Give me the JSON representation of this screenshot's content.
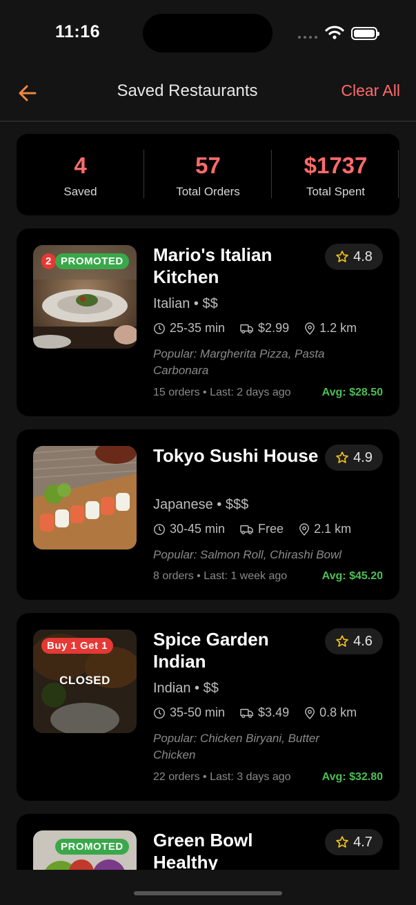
{
  "status": {
    "time": "11:16"
  },
  "header": {
    "title": "Saved Restaurants",
    "clear_label": "Clear All"
  },
  "stats": [
    {
      "value": "4",
      "label": "Saved"
    },
    {
      "value": "57",
      "label": "Total Orders"
    },
    {
      "value": "$1737",
      "label": "Total Spent"
    }
  ],
  "restaurants": [
    {
      "name": "Mario's Italian Kitchen",
      "rating": "4.8",
      "cuisine": "Italian",
      "price": "$$",
      "time": "25-35 min",
      "delivery": "$2.99",
      "distance": "1.2 km",
      "popular": "Popular: Margherita Pizza, Pasta Carbonara",
      "orders": "15 orders",
      "last": "Last: 2 days ago",
      "avg": "Avg: $28.50",
      "badge_num": "2",
      "badge": "PROMOTED"
    },
    {
      "name": "Tokyo Sushi House",
      "rating": "4.9",
      "cuisine": "Japanese",
      "price": "$$$",
      "time": "30-45 min",
      "delivery": "Free",
      "distance": "2.1 km",
      "popular": "Popular: Salmon Roll, Chirashi Bowl",
      "orders": "8 orders",
      "last": "Last: 1 week ago",
      "avg": "Avg: $45.20"
    },
    {
      "name": "Spice Garden Indian",
      "rating": "4.6",
      "cuisine": "Indian",
      "price": "$$",
      "time": "35-50 min",
      "delivery": "$3.49",
      "distance": "0.8 km",
      "popular": "Popular: Chicken Biryani, Butter Chicken",
      "orders": "22 orders",
      "last": "Last: 3 days ago",
      "avg": "Avg: $32.80",
      "badge": "Buy 1 Get 1",
      "closed": "CLOSED"
    },
    {
      "name": "Green Bowl Healthy",
      "rating": "4.7",
      "badge": "PROMOTED"
    }
  ],
  "colors": {
    "accent": "#ff6b6b",
    "back_arrow": "#f0883e",
    "avg_green": "#4cbf56",
    "promoted": "#3aa84a",
    "deal": "#e53935"
  }
}
